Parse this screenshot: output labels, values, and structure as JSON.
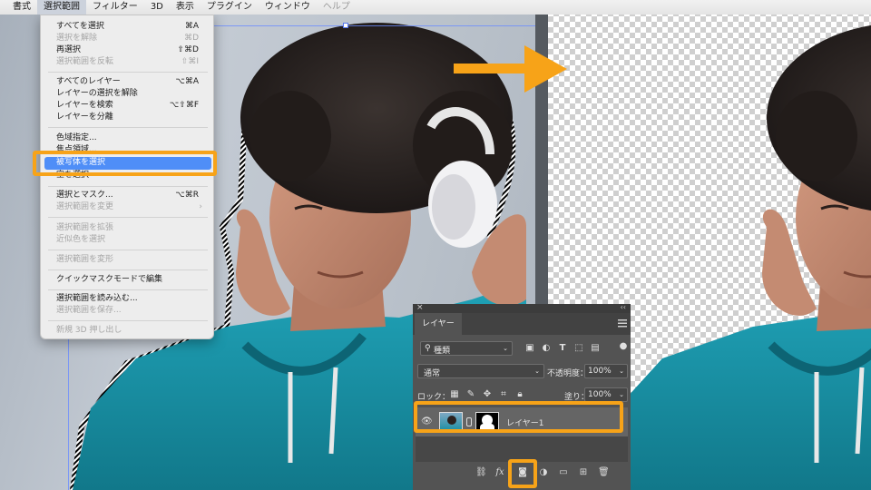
{
  "menubar": {
    "items": [
      {
        "label": "書式",
        "state": "normal"
      },
      {
        "label": "選択範囲",
        "state": "active"
      },
      {
        "label": "フィルター",
        "state": "normal"
      },
      {
        "label": "3D",
        "state": "normal"
      },
      {
        "label": "表示",
        "state": "normal"
      },
      {
        "label": "プラグイン",
        "state": "normal"
      },
      {
        "label": "ウィンドウ",
        "state": "normal"
      },
      {
        "label": "ヘルプ",
        "state": "disabled"
      }
    ]
  },
  "dropdown": {
    "items": [
      {
        "label": "すべてを選択",
        "shortcut": "⌘A",
        "disabled": false
      },
      {
        "label": "選択を解除",
        "shortcut": "⌘D",
        "disabled": true
      },
      {
        "label": "再選択",
        "shortcut": "⇧⌘D",
        "disabled": false
      },
      {
        "label": "選択範囲を反転",
        "shortcut": "⇧⌘I",
        "disabled": true
      },
      {
        "label": "すべてのレイヤー",
        "shortcut": "⌥⌘A",
        "disabled": false
      },
      {
        "label": "レイヤーの選択を解除",
        "shortcut": "",
        "disabled": false
      },
      {
        "label": "レイヤーを検索",
        "shortcut": "⌥⇧⌘F",
        "disabled": false
      },
      {
        "label": "レイヤーを分離",
        "shortcut": "",
        "disabled": false
      },
      {
        "label": "色域指定...",
        "shortcut": "",
        "disabled": false
      },
      {
        "label": "焦点領域...",
        "shortcut": "",
        "disabled": false
      },
      {
        "label": "被写体を選択",
        "shortcut": "",
        "disabled": false,
        "highlighted": true
      },
      {
        "label": "空を選択",
        "shortcut": "",
        "disabled": false
      },
      {
        "label": "選択とマスク...",
        "shortcut": "⌥⌘R",
        "disabled": false
      },
      {
        "label": "選択範囲を変更",
        "shortcut": "",
        "disabled": true,
        "submenu": true
      },
      {
        "label": "選択範囲を拡張",
        "shortcut": "",
        "disabled": true
      },
      {
        "label": "近似色を選択",
        "shortcut": "",
        "disabled": true
      },
      {
        "label": "選択範囲を変形",
        "shortcut": "",
        "disabled": true
      },
      {
        "label": "クイックマスクモードで編集",
        "shortcut": "",
        "disabled": false
      },
      {
        "label": "選択範囲を読み込む...",
        "shortcut": "",
        "disabled": false
      },
      {
        "label": "選択範囲を保存...",
        "shortcut": "",
        "disabled": true
      },
      {
        "label": "新規 3D 押し出し",
        "shortcut": "",
        "disabled": true
      }
    ]
  },
  "layers_panel": {
    "tab_label": "レイヤー",
    "filter_kind": "種類",
    "blend_mode": "通常",
    "opacity_label": "不透明度：",
    "opacity_value": "100%",
    "lock_label": "ロック：",
    "fill_label": "塗り：",
    "fill_value": "100%",
    "layer_name": "レイヤー1",
    "footer_fx": "fx"
  },
  "icons": {
    "close": "close-icon",
    "panel_collapse": "double-chevron-icon",
    "panel_menu": "hamburger-menu-icon",
    "search": "search-icon",
    "visibility": "eye-icon",
    "link": "link-icon",
    "mask": "layer-mask-icon",
    "adjustment": "adjustment-layer-icon",
    "folder": "folder-icon",
    "new_layer": "new-layer-icon",
    "trash": "trash-icon"
  },
  "colors": {
    "highlight_orange": "#f7a318",
    "menu_selection_blue": "#4f8ef7",
    "panel_bg": "#535353",
    "hoodie_teal": "#1a93a8"
  }
}
